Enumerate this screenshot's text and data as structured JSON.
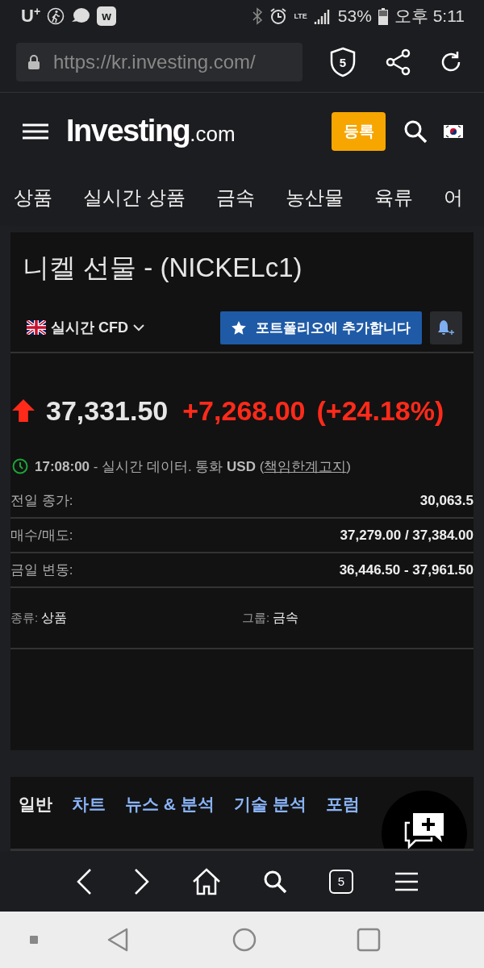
{
  "status_bar": {
    "carrier": "U$^{+}$",
    "app_badge": "w",
    "network": "LTE",
    "battery": "53%",
    "time": "오후 5:11"
  },
  "url_bar": {
    "url": "https://kr.investing.com/",
    "shield_count": "5"
  },
  "header": {
    "logo_main": "Investing",
    "logo_suffix": ".com",
    "register": "등록"
  },
  "categories": [
    "상품",
    "실시간 상품",
    "금속",
    "농산물",
    "육류",
    "어"
  ],
  "quote": {
    "title": "니켈 선물 - (NICKELc1)",
    "source": "실시간 CFD",
    "portfolio_button": "포트폴리오에 추가합니다",
    "rising": true,
    "price": "37,331.50",
    "change": "+7,268.00",
    "change_pct": "(+24.18%)",
    "note": "**17:08:00** - 실시간 데이터.  통화 **USD**  (",
    "disclaimer": "책임한계고지",
    "note_end": ")",
    "rows": [
      {
        "label": "전일 종가:",
        "value": "30,063.5"
      },
      {
        "label": "매수/매도:",
        "value": "37,279.00 / 37,384.00"
      },
      {
        "label": "금일 변동:",
        "value": "36,446.50 - 37,961.50"
      }
    ],
    "details": [
      {
        "label": "종류:",
        "value": "상품"
      },
      {
        "label": "그룹:",
        "value": "금속"
      }
    ]
  },
  "section_tabs": [
    {
      "label": "일반",
      "selected": true
    },
    {
      "label": "차트",
      "selected": false
    },
    {
      "label": "뉴스 & 분석",
      "selected": false
    },
    {
      "label": "기술 분석",
      "selected": false
    },
    {
      "label": "포럼",
      "selected": false
    }
  ],
  "browser_toolbar": {
    "tab_count": "5"
  }
}
